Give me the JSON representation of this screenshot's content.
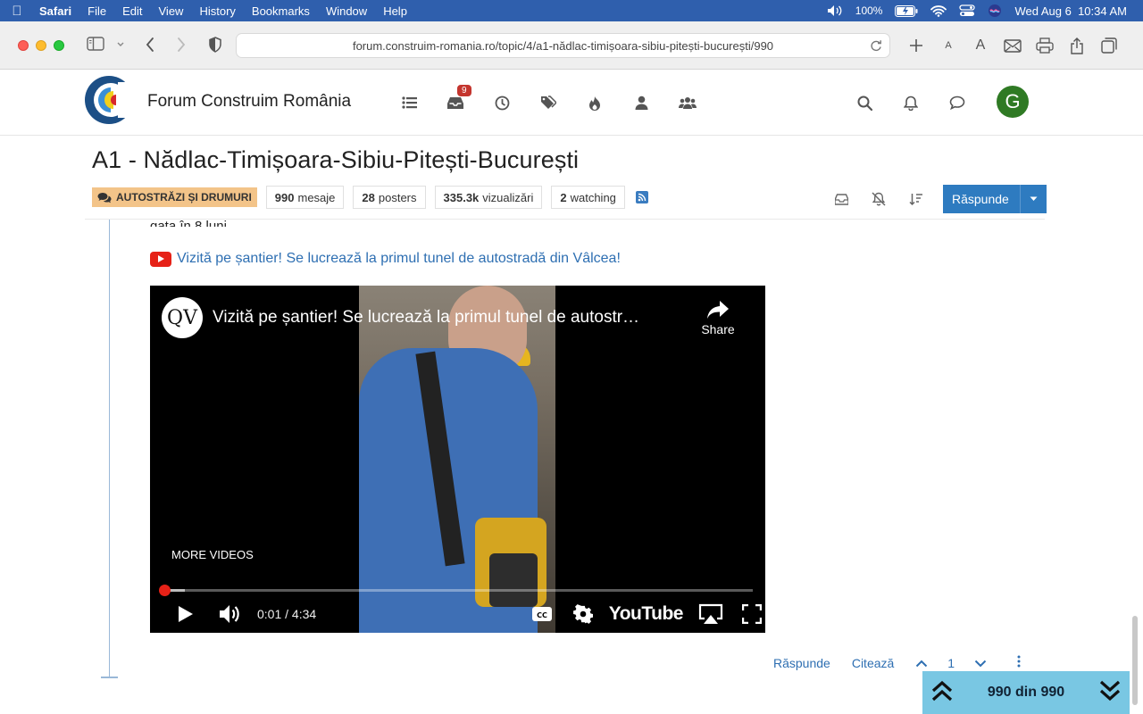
{
  "menubar": {
    "app": "Safari",
    "items": [
      "File",
      "Edit",
      "View",
      "History",
      "Bookmarks",
      "Window",
      "Help"
    ],
    "battery": "100%",
    "datetime": "Wed Aug 6  10:34 AM"
  },
  "browser": {
    "url": "forum.construim-romania.ro/topic/4/a1-nădlac-timișoara-sibiu-pitești-bucurești/990"
  },
  "header": {
    "site_name": "Forum Construim România",
    "notification_count": "9",
    "avatar_letter": "G"
  },
  "topic": {
    "title": "A1 - Nădlac-Timișoara-Sibiu-Pitești-București",
    "category": "AUTOSTRĂZI ȘI DRUMURI",
    "stats": {
      "posts_value": "990",
      "posts_label": "mesaje",
      "posters_value": "28",
      "posters_label": "posters",
      "views_value": "335.3k",
      "views_label": "vizualizări",
      "watching_value": "2",
      "watching_label": "watching"
    },
    "reply_label": "Răspunde"
  },
  "post": {
    "text_fragment": "gata în 8 luni.",
    "video_link": "Vizită pe șantier! Se lucrează la primul tunel de autostradă din Vâlcea!",
    "actions": {
      "reply": "Răspunde",
      "quote": "Citează",
      "vote_count": "1"
    }
  },
  "video": {
    "channel_logo": "QV",
    "title": "Vizită pe șantier! Se lucrează la primul tunel de autostr…",
    "share_label": "Share",
    "more_videos": "MORE VIDEOS",
    "current_time": "0:01",
    "duration": "4:34",
    "time_display": "0:01 / 4:34",
    "progress_fraction": 0.004,
    "buffer_fraction": 0.04,
    "cc_label": "CC",
    "brand": "YouTube"
  },
  "progress_widget": {
    "label": "990 din 990"
  },
  "colors": {
    "menubar": "#2f5fad",
    "accent_blue": "#2e7bc0",
    "link_blue": "#2e6fb2",
    "category_bg": "#f3c489",
    "badge_red": "#c4352e",
    "avatar_green": "#2f7a24",
    "youtube_red": "#e62117",
    "progress_widget_bg": "#79c7e3"
  }
}
